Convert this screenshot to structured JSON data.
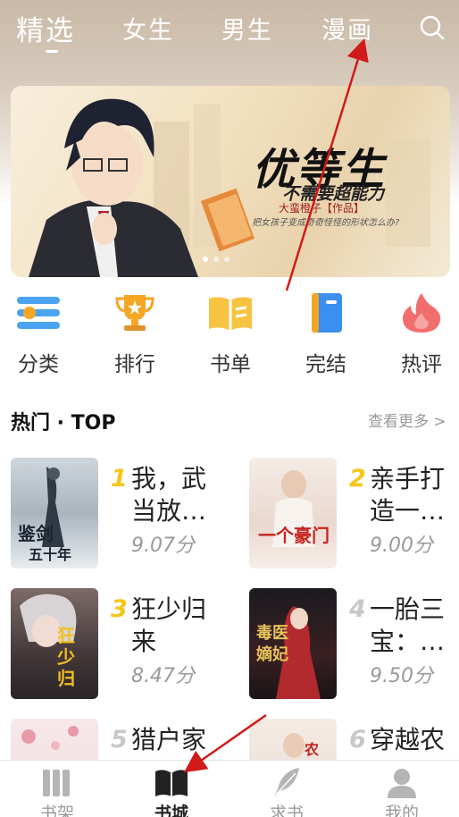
{
  "header": {
    "tabs": [
      {
        "label": "精选",
        "active": true
      },
      {
        "label": "女生",
        "active": false
      },
      {
        "label": "男生",
        "active": false
      },
      {
        "label": "漫画",
        "active": false
      }
    ],
    "search_icon": "search-icon"
  },
  "banner": {
    "title": "优等生",
    "subtitle": "不需要超能力",
    "author": "大蛮橙子【作品】",
    "description": "把女孩子变成奇奇怪怪的形状怎么办?"
  },
  "categories": [
    {
      "label": "分类",
      "icon": "category-icon",
      "color": "#4aa3f0"
    },
    {
      "label": "排行",
      "icon": "trophy-icon",
      "color": "#f5a623"
    },
    {
      "label": "书单",
      "icon": "booklist-icon",
      "color": "#f6c343"
    },
    {
      "label": "完结",
      "icon": "finished-book-icon",
      "color": "#3b8ff0"
    },
    {
      "label": "热评",
      "icon": "flame-icon",
      "color": "#f26d6d"
    }
  ],
  "section": {
    "title": "热门 · TOP",
    "see_more": "查看更多 >"
  },
  "books": [
    {
      "rank": "1",
      "title": "我，武当放…",
      "score": "9.07分",
      "rank_color": "#f5c518"
    },
    {
      "rank": "2",
      "title": "亲手打造一…",
      "score": "9.00分",
      "rank_color": "#f5c518"
    },
    {
      "rank": "3",
      "title": "狂少归来",
      "score": "8.47分",
      "rank_color": "#f5c518"
    },
    {
      "rank": "4",
      "title": "一胎三宝：…",
      "score": "9.50分",
      "rank_color": "#c8c8c8"
    },
    {
      "rank": "5",
      "title": "猎户家",
      "score": "",
      "rank_color": "#c8c8c8"
    },
    {
      "rank": "6",
      "title": "穿越农",
      "score": "",
      "rank_color": "#c8c8c8"
    }
  ],
  "bottom_nav": [
    {
      "label": "书架",
      "icon": "bookshelf-icon",
      "active": false
    },
    {
      "label": "书城",
      "icon": "bookstore-icon",
      "active": true
    },
    {
      "label": "求书",
      "icon": "feather-icon",
      "active": false
    },
    {
      "label": "我的",
      "icon": "user-icon",
      "active": false
    }
  ]
}
